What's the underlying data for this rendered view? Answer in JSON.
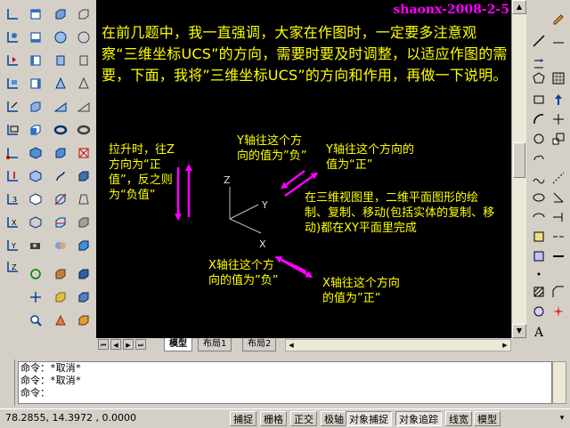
{
  "watermark": "shaonx-2008-2-5",
  "intro": "在前几题中，我一直强调，大家在作图时，一定要多注意观察“三维坐标UCS”的方向，需要时要及时调整，以适应作图的需要，下面，我将”三维坐标UCS”的方向和作用，再做一下说明。",
  "notes": {
    "z_note": "拉升时，往Z方向为“正值”，反之则为“负值”",
    "y_neg": "Y轴往这个方向的值为”负”",
    "y_pos": "Y轴往这个方向的值为“正”",
    "plane": "在三维视图里，二维平面图形的绘制、复制、移动(包括实体的复制、移动)都在XY平面里完成",
    "x_neg": "X轴往这个方向的值为”负”",
    "x_pos": "X轴往这个方向的值为”正”"
  },
  "axes": {
    "z": "Z",
    "y": "Y",
    "x": "X"
  },
  "tabs": [
    "模型",
    "布局1",
    "布局2"
  ],
  "command_lines": [
    "命令：*取消*",
    "命令：*取消*",
    "命令："
  ],
  "status": {
    "coords": "78.2855, 14.3972 , 0.0000",
    "buttons": [
      "捕捉",
      "栅格",
      "正交",
      "极轴",
      "对象捕捉",
      "对象追踪",
      "线宽",
      "模型"
    ]
  },
  "colors": {
    "text": "#ffff00",
    "arrow": "#ff00ff",
    "canvas": "#000000"
  }
}
